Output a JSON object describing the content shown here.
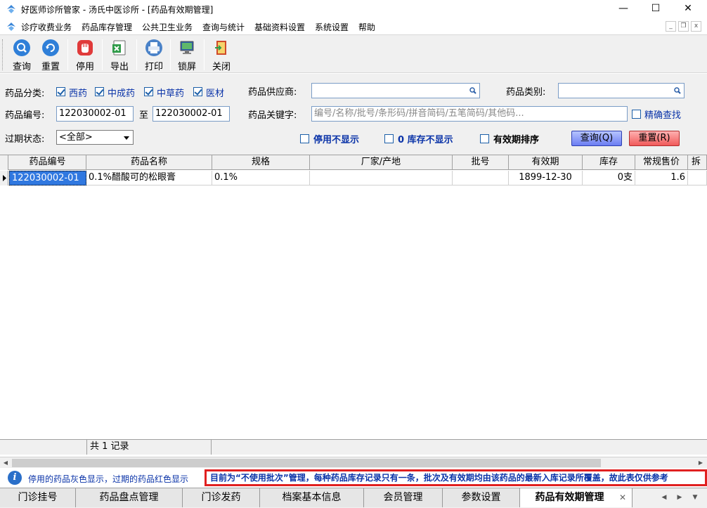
{
  "window": {
    "title": "好医师诊所管家 - 汤氏中医诊所 - [药品有效期管理]",
    "minimize_glyph": "—",
    "maximize_glyph": "☐",
    "close_glyph": "✕"
  },
  "menu": {
    "items": [
      "诊疗收费业务",
      "药品库存管理",
      "公共卫生业务",
      "查询与统计",
      "基础资料设置",
      "系统设置",
      "帮助"
    ],
    "mdi_min": "_",
    "mdi_restore": "❐",
    "mdi_close": "x"
  },
  "toolbar": {
    "buttons": [
      {
        "label": "查询",
        "icon": "search-icon",
        "color": "#2f7fd8"
      },
      {
        "label": "重置",
        "icon": "refresh-icon",
        "color": "#2f7fd8"
      },
      {
        "label": "停用",
        "icon": "stop-hand-icon",
        "color": "#e03a3a"
      },
      {
        "label": "导出",
        "icon": "excel-export-icon",
        "color": "#2e9b48"
      },
      {
        "label": "打印",
        "icon": "printer-icon",
        "color": "#4a82c8"
      },
      {
        "label": "锁屏",
        "icon": "lock-screen-icon",
        "color": "#3a9a4a"
      },
      {
        "label": "关闭",
        "icon": "exit-door-icon",
        "color": "#d04a2a"
      }
    ]
  },
  "filters": {
    "category_label": "药品分类:",
    "categories": [
      {
        "label": "西药",
        "checked": true
      },
      {
        "label": "中成药",
        "checked": true
      },
      {
        "label": "中草药",
        "checked": true
      },
      {
        "label": "医材",
        "checked": true
      }
    ],
    "supplier_label": "药品供应商:",
    "supplier_value": "",
    "type_label": "药品类别:",
    "type_value": "",
    "code_label": "药品编号:",
    "code_from": "122030002-01",
    "code_to_label": "至",
    "code_to": "122030002-01",
    "keyword_label": "药品关键字:",
    "keyword_placeholder": "编号/名称/批号/条形码/拼音简码/五笔简码/其他码...",
    "exact_label": "精确查找",
    "exact_checked": false,
    "expiry_label": "过期状态:",
    "expiry_value": "<全部>",
    "hide_disabled_label": "停用不显示",
    "hide_disabled_checked": false,
    "hide_zero_label": "0  库存不显示",
    "hide_zero_checked": false,
    "sort_expiry_label": "有效期排序",
    "sort_expiry_checked": false,
    "query_button": "查询(Q)",
    "reset_button": "重置(R)"
  },
  "grid": {
    "columns": [
      "药品编号",
      "药品名称",
      "规格",
      "厂家/产地",
      "批号",
      "有效期",
      "库存",
      "常规售价",
      "拆"
    ],
    "rows": [
      [
        "122030002-01",
        "0.1%醋酸可的松眼膏",
        "0.1%",
        "",
        "",
        "1899-12-30",
        "0支",
        "1.6",
        ""
      ]
    ],
    "footer": "共 1 记录"
  },
  "info": {
    "legend": "停用的药品灰色显示，过期的药品红色显示",
    "notice": "目前为“不使用批次”管理，每种药品库存记录只有一条，批次及有效期均由该药品的最新入库记录所覆盖，故此表仅供参考"
  },
  "tabs": [
    {
      "label": "门诊挂号",
      "active": false
    },
    {
      "label": "药品盘点管理",
      "active": false
    },
    {
      "label": "门诊发药",
      "active": false
    },
    {
      "label": "档案基本信息",
      "active": false
    },
    {
      "label": "会员管理",
      "active": false
    },
    {
      "label": "参数设置",
      "active": false
    },
    {
      "label": "药品有效期管理",
      "active": true
    }
  ],
  "tab_close_glyph": "✕",
  "colors": {
    "accent_blue": "#0a33a8",
    "selection": "#3078e0",
    "notice_border": "#e02020"
  }
}
